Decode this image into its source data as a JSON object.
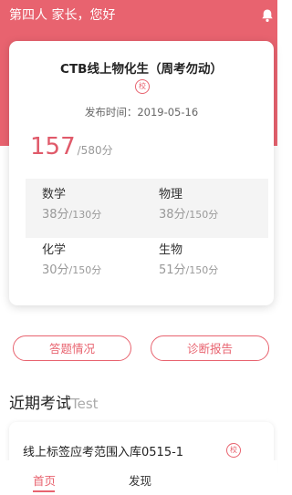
{
  "header": {
    "greeting": "第四人 家长，您好",
    "bell_icon": "bell-icon"
  },
  "exam": {
    "title": "CTB线上物化生（周考勿动）",
    "school_tag": "校",
    "publish_label": "发布时间：",
    "publish_date": "2019-05-16",
    "score": "157",
    "total": "/580分"
  },
  "subjects": [
    {
      "name": "数学",
      "score": "38分",
      "total": "/130分"
    },
    {
      "name": "物理",
      "score": "38分",
      "total": "/150分"
    },
    {
      "name": "化学",
      "score": "30分",
      "total": "/150分"
    },
    {
      "name": "生物",
      "score": "51分",
      "total": "/150分"
    }
  ],
  "buttons": {
    "answers": "答题情况",
    "diagnosis": "诊断报告"
  },
  "recent": {
    "title": "近期考试",
    "title_en": "Test",
    "items": [
      {
        "name": "线上标签应考范围入库0515-1",
        "tag": "校"
      }
    ]
  },
  "nav": {
    "home": "首页",
    "discover": "发现"
  },
  "colors": {
    "accent": "#e8636f",
    "score": "#e05a6a"
  }
}
